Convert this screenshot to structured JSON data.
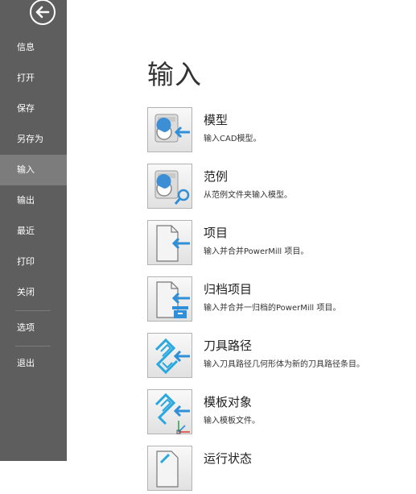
{
  "sidebar": {
    "back_label": "返回",
    "items": [
      {
        "label": "信息"
      },
      {
        "label": "打开"
      },
      {
        "label": "保存"
      },
      {
        "label": "另存为"
      },
      {
        "label": "输入",
        "active": true
      },
      {
        "label": "输出"
      },
      {
        "label": "最近"
      },
      {
        "label": "打印"
      },
      {
        "label": "关闭"
      },
      {
        "label": "选项"
      },
      {
        "label": "退出"
      }
    ]
  },
  "main": {
    "title": "输入",
    "items": [
      {
        "title": "模型",
        "desc": "输入CAD模型。",
        "icon": "model-import-icon"
      },
      {
        "title": "范例",
        "desc": "从范例文件夹输入模型。",
        "icon": "example-search-icon"
      },
      {
        "title": "项目",
        "desc": "输入并合并PowerMill 项目。",
        "icon": "project-import-icon"
      },
      {
        "title": "归档项目",
        "desc": "输入并合并一归档的PowerMill 项目。",
        "icon": "archive-project-icon"
      },
      {
        "title": "刀具路径",
        "desc": "输入刀具路径几何形体为新的刀具路径条目。",
        "icon": "toolpath-import-icon"
      },
      {
        "title": "模板对象",
        "desc": "输入模板文件。",
        "icon": "template-object-icon"
      },
      {
        "title": "运行状态",
        "desc": "",
        "icon": "run-state-icon"
      }
    ]
  },
  "colors": {
    "sidebar_bg": "#5e5e5e",
    "sidebar_active": "#7c7c7c",
    "accent_blue": "#2f8fd8",
    "toolpath_cyan": "#29a8df"
  }
}
